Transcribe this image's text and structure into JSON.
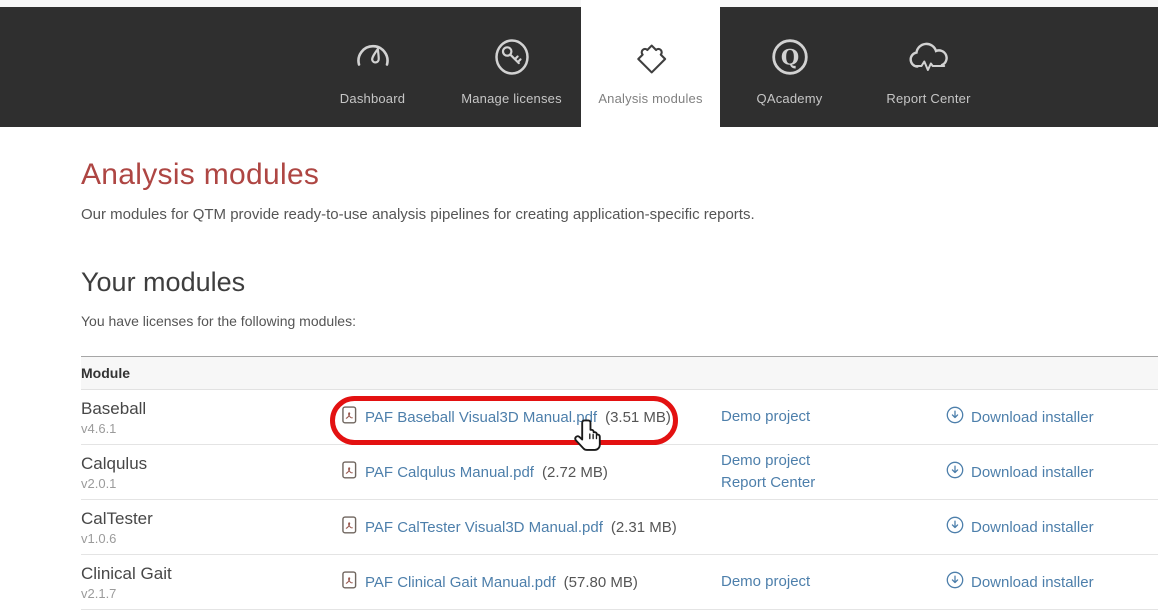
{
  "nav": {
    "active_tab": "Analysis modules",
    "tabs": [
      {
        "label": "Dashboard",
        "icon": "gauge-icon"
      },
      {
        "label": "Manage licenses",
        "icon": "key-icon"
      },
      {
        "label": "Analysis modules",
        "icon": "puzzle-icon"
      },
      {
        "label": "QAcademy",
        "icon": "q-badge-icon"
      },
      {
        "label": "Report Center",
        "icon": "cloud-waveform-icon"
      }
    ]
  },
  "page": {
    "title": "Analysis modules",
    "intro": "Our modules for QTM provide ready-to-use analysis pipelines for creating application-specific reports.",
    "section_heading": "Your modules",
    "section_intro": "You have licenses for the following modules:"
  },
  "table": {
    "header": "Module",
    "rows": [
      {
        "name": "Baseball",
        "version": "v4.6.1",
        "manual": "PAF Baseball Visual3D Manual.pdf",
        "size": "(3.51 MB)",
        "links": [
          "Demo project"
        ],
        "installer": "Download installer"
      },
      {
        "name": "Calqulus",
        "version": "v2.0.1",
        "manual": "PAF Calqulus Manual.pdf",
        "size": "(2.72 MB)",
        "links": [
          "Demo project",
          "Report Center"
        ],
        "installer": "Download installer"
      },
      {
        "name": "CalTester",
        "version": "v1.0.6",
        "manual": "PAF CalTester Visual3D Manual.pdf",
        "size": "(2.31 MB)",
        "links": [],
        "installer": "Download installer"
      },
      {
        "name": "Clinical Gait",
        "version": "v2.1.7",
        "manual": "PAF Clinical Gait Manual.pdf",
        "size": "(57.80 MB)",
        "links": [
          "Demo project"
        ],
        "installer": "Download installer"
      }
    ]
  },
  "colors": {
    "heading_red": "#ae4643",
    "link_blue": "#4d7fab",
    "nav_background": "#2f2f2f",
    "active_tab_background": "#ffffff",
    "highlight_red": "#e31111"
  }
}
